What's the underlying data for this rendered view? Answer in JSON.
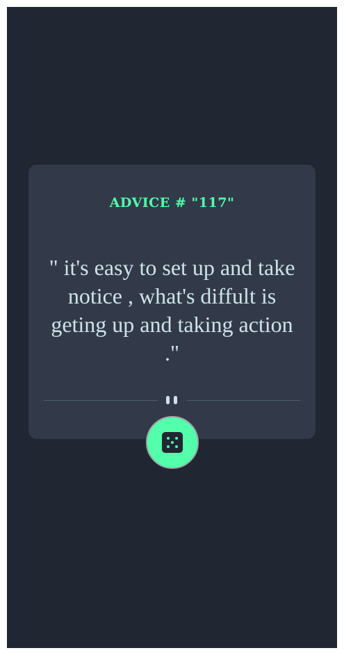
{
  "advice": {
    "heading": "ADVICE # \"117\"",
    "quote": "\" it's easy to set up and take notice , what's diffult is geting up and taking action .\""
  },
  "controls": {
    "divider_icon": "pause-icon",
    "dice_button_icon": "dice-icon"
  },
  "colors": {
    "background": "#202632",
    "card": "#323a49",
    "accent": "#53ffaa",
    "text": "#cee3e9",
    "divider": "#4e5d73"
  }
}
